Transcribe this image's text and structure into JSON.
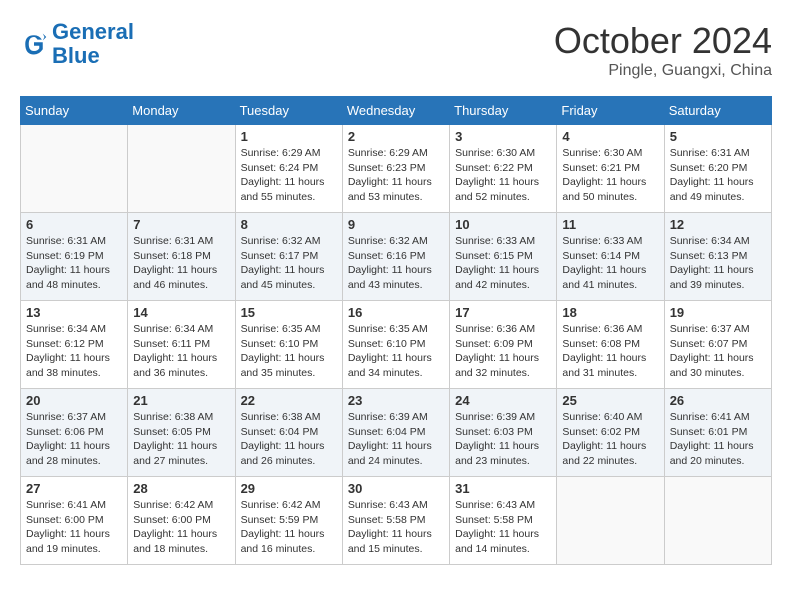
{
  "header": {
    "logo_general": "General",
    "logo_blue": "Blue",
    "month_title": "October 2024",
    "location": "Pingle, Guangxi, China"
  },
  "weekdays": [
    "Sunday",
    "Monday",
    "Tuesday",
    "Wednesday",
    "Thursday",
    "Friday",
    "Saturday"
  ],
  "weeks": [
    [
      {
        "day": "",
        "empty": true
      },
      {
        "day": "",
        "empty": true
      },
      {
        "day": "1",
        "sunrise": "6:29 AM",
        "sunset": "6:24 PM",
        "daylight": "11 hours and 55 minutes."
      },
      {
        "day": "2",
        "sunrise": "6:29 AM",
        "sunset": "6:23 PM",
        "daylight": "11 hours and 53 minutes."
      },
      {
        "day": "3",
        "sunrise": "6:30 AM",
        "sunset": "6:22 PM",
        "daylight": "11 hours and 52 minutes."
      },
      {
        "day": "4",
        "sunrise": "6:30 AM",
        "sunset": "6:21 PM",
        "daylight": "11 hours and 50 minutes."
      },
      {
        "day": "5",
        "sunrise": "6:31 AM",
        "sunset": "6:20 PM",
        "daylight": "11 hours and 49 minutes."
      }
    ],
    [
      {
        "day": "6",
        "sunrise": "6:31 AM",
        "sunset": "6:19 PM",
        "daylight": "11 hours and 48 minutes."
      },
      {
        "day": "7",
        "sunrise": "6:31 AM",
        "sunset": "6:18 PM",
        "daylight": "11 hours and 46 minutes."
      },
      {
        "day": "8",
        "sunrise": "6:32 AM",
        "sunset": "6:17 PM",
        "daylight": "11 hours and 45 minutes."
      },
      {
        "day": "9",
        "sunrise": "6:32 AM",
        "sunset": "6:16 PM",
        "daylight": "11 hours and 43 minutes."
      },
      {
        "day": "10",
        "sunrise": "6:33 AM",
        "sunset": "6:15 PM",
        "daylight": "11 hours and 42 minutes."
      },
      {
        "day": "11",
        "sunrise": "6:33 AM",
        "sunset": "6:14 PM",
        "daylight": "11 hours and 41 minutes."
      },
      {
        "day": "12",
        "sunrise": "6:34 AM",
        "sunset": "6:13 PM",
        "daylight": "11 hours and 39 minutes."
      }
    ],
    [
      {
        "day": "13",
        "sunrise": "6:34 AM",
        "sunset": "6:12 PM",
        "daylight": "11 hours and 38 minutes."
      },
      {
        "day": "14",
        "sunrise": "6:34 AM",
        "sunset": "6:11 PM",
        "daylight": "11 hours and 36 minutes."
      },
      {
        "day": "15",
        "sunrise": "6:35 AM",
        "sunset": "6:10 PM",
        "daylight": "11 hours and 35 minutes."
      },
      {
        "day": "16",
        "sunrise": "6:35 AM",
        "sunset": "6:10 PM",
        "daylight": "11 hours and 34 minutes."
      },
      {
        "day": "17",
        "sunrise": "6:36 AM",
        "sunset": "6:09 PM",
        "daylight": "11 hours and 32 minutes."
      },
      {
        "day": "18",
        "sunrise": "6:36 AM",
        "sunset": "6:08 PM",
        "daylight": "11 hours and 31 minutes."
      },
      {
        "day": "19",
        "sunrise": "6:37 AM",
        "sunset": "6:07 PM",
        "daylight": "11 hours and 30 minutes."
      }
    ],
    [
      {
        "day": "20",
        "sunrise": "6:37 AM",
        "sunset": "6:06 PM",
        "daylight": "11 hours and 28 minutes."
      },
      {
        "day": "21",
        "sunrise": "6:38 AM",
        "sunset": "6:05 PM",
        "daylight": "11 hours and 27 minutes."
      },
      {
        "day": "22",
        "sunrise": "6:38 AM",
        "sunset": "6:04 PM",
        "daylight": "11 hours and 26 minutes."
      },
      {
        "day": "23",
        "sunrise": "6:39 AM",
        "sunset": "6:04 PM",
        "daylight": "11 hours and 24 minutes."
      },
      {
        "day": "24",
        "sunrise": "6:39 AM",
        "sunset": "6:03 PM",
        "daylight": "11 hours and 23 minutes."
      },
      {
        "day": "25",
        "sunrise": "6:40 AM",
        "sunset": "6:02 PM",
        "daylight": "11 hours and 22 minutes."
      },
      {
        "day": "26",
        "sunrise": "6:41 AM",
        "sunset": "6:01 PM",
        "daylight": "11 hours and 20 minutes."
      }
    ],
    [
      {
        "day": "27",
        "sunrise": "6:41 AM",
        "sunset": "6:00 PM",
        "daylight": "11 hours and 19 minutes."
      },
      {
        "day": "28",
        "sunrise": "6:42 AM",
        "sunset": "6:00 PM",
        "daylight": "11 hours and 18 minutes."
      },
      {
        "day": "29",
        "sunrise": "6:42 AM",
        "sunset": "5:59 PM",
        "daylight": "11 hours and 16 minutes."
      },
      {
        "day": "30",
        "sunrise": "6:43 AM",
        "sunset": "5:58 PM",
        "daylight": "11 hours and 15 minutes."
      },
      {
        "day": "31",
        "sunrise": "6:43 AM",
        "sunset": "5:58 PM",
        "daylight": "11 hours and 14 minutes."
      },
      {
        "day": "",
        "empty": true
      },
      {
        "day": "",
        "empty": true
      }
    ]
  ],
  "labels": {
    "sunrise": "Sunrise:",
    "sunset": "Sunset:",
    "daylight": "Daylight:"
  }
}
